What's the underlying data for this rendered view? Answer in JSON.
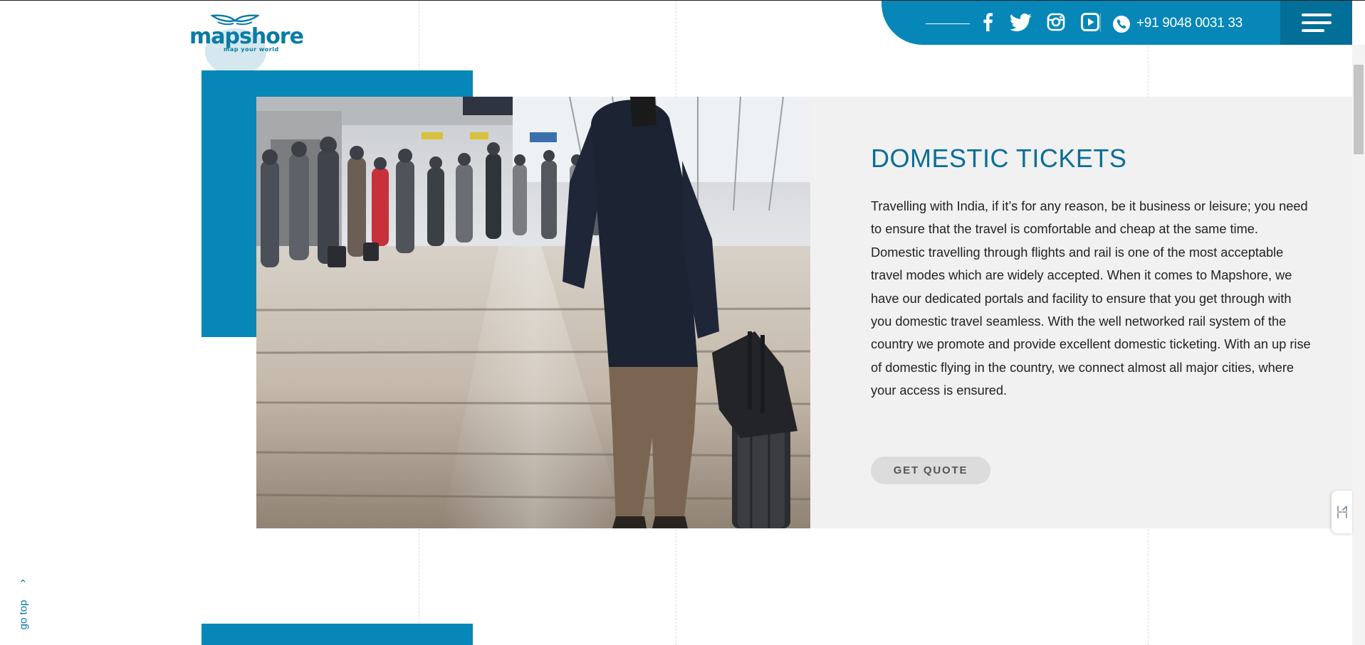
{
  "brand": {
    "name": "mapshore",
    "tagline": "map your world",
    "color": "#0a7ba6"
  },
  "topbar": {
    "background": "#0687b8",
    "social": [
      {
        "name": "facebook",
        "icon": "facebook-icon"
      },
      {
        "name": "twitter",
        "icon": "twitter-icon"
      },
      {
        "name": "instagram",
        "icon": "instagram-icon"
      },
      {
        "name": "youtube",
        "icon": "youtube-icon"
      }
    ],
    "phone_icon": "phone-icon",
    "phone": "+91 9048 0031 33",
    "menu_icon": "hamburger-menu-icon"
  },
  "section": {
    "title": "DOMESTIC TICKETS",
    "body": "Travelling with India, if it’s for any reason, be it business or leisure; you need to ensure that the travel is comfortable and cheap at the same time. Domestic travelling through flights and rail is one of the most acceptable travel modes which are widely accepted. When it comes to Mapshore, we have our dedicated portals and facility to ensure that you get through with you domestic travel seamless. With the well networked rail system of the country we promote and provide excellent domestic ticketing. With an up rise of domestic flying in the country, we connect almost all major cities, where your access is ensured.",
    "button": "GET QUOTE",
    "image_subject": "traveller-with-luggage-in-airport-photo",
    "title_color": "#0a6f96",
    "panel_color": "#f1f1f1"
  },
  "gotop": {
    "label": "go top",
    "icon": "chevron-up-icon"
  },
  "side_widget": {
    "icon": "widget-tab-icon"
  }
}
